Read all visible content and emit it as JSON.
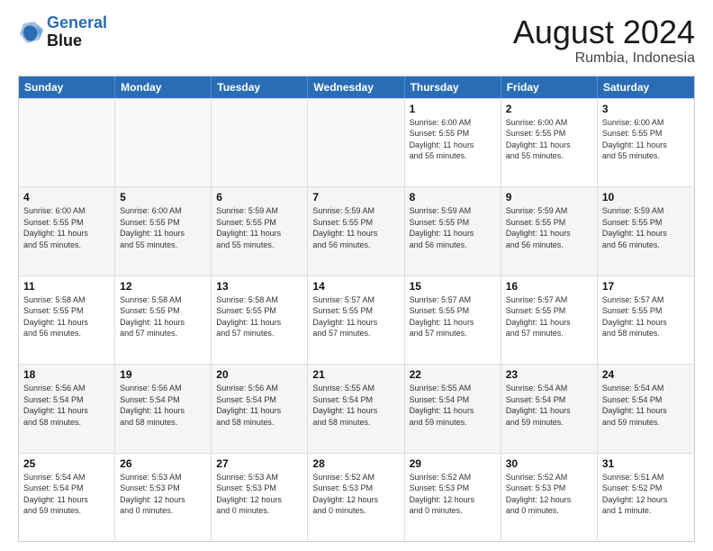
{
  "header": {
    "logo_line1": "General",
    "logo_line2": "Blue",
    "month": "August 2024",
    "location": "Rumbia, Indonesia"
  },
  "weekdays": [
    "Sunday",
    "Monday",
    "Tuesday",
    "Wednesday",
    "Thursday",
    "Friday",
    "Saturday"
  ],
  "rows": [
    [
      {
        "day": "",
        "info": ""
      },
      {
        "day": "",
        "info": ""
      },
      {
        "day": "",
        "info": ""
      },
      {
        "day": "",
        "info": ""
      },
      {
        "day": "1",
        "info": "Sunrise: 6:00 AM\nSunset: 5:55 PM\nDaylight: 11 hours\nand 55 minutes."
      },
      {
        "day": "2",
        "info": "Sunrise: 6:00 AM\nSunset: 5:55 PM\nDaylight: 11 hours\nand 55 minutes."
      },
      {
        "day": "3",
        "info": "Sunrise: 6:00 AM\nSunset: 5:55 PM\nDaylight: 11 hours\nand 55 minutes."
      }
    ],
    [
      {
        "day": "4",
        "info": "Sunrise: 6:00 AM\nSunset: 5:55 PM\nDaylight: 11 hours\nand 55 minutes."
      },
      {
        "day": "5",
        "info": "Sunrise: 6:00 AM\nSunset: 5:55 PM\nDaylight: 11 hours\nand 55 minutes."
      },
      {
        "day": "6",
        "info": "Sunrise: 5:59 AM\nSunset: 5:55 PM\nDaylight: 11 hours\nand 55 minutes."
      },
      {
        "day": "7",
        "info": "Sunrise: 5:59 AM\nSunset: 5:55 PM\nDaylight: 11 hours\nand 56 minutes."
      },
      {
        "day": "8",
        "info": "Sunrise: 5:59 AM\nSunset: 5:55 PM\nDaylight: 11 hours\nand 56 minutes."
      },
      {
        "day": "9",
        "info": "Sunrise: 5:59 AM\nSunset: 5:55 PM\nDaylight: 11 hours\nand 56 minutes."
      },
      {
        "day": "10",
        "info": "Sunrise: 5:59 AM\nSunset: 5:55 PM\nDaylight: 11 hours\nand 56 minutes."
      }
    ],
    [
      {
        "day": "11",
        "info": "Sunrise: 5:58 AM\nSunset: 5:55 PM\nDaylight: 11 hours\nand 56 minutes."
      },
      {
        "day": "12",
        "info": "Sunrise: 5:58 AM\nSunset: 5:55 PM\nDaylight: 11 hours\nand 57 minutes."
      },
      {
        "day": "13",
        "info": "Sunrise: 5:58 AM\nSunset: 5:55 PM\nDaylight: 11 hours\nand 57 minutes."
      },
      {
        "day": "14",
        "info": "Sunrise: 5:57 AM\nSunset: 5:55 PM\nDaylight: 11 hours\nand 57 minutes."
      },
      {
        "day": "15",
        "info": "Sunrise: 5:57 AM\nSunset: 5:55 PM\nDaylight: 11 hours\nand 57 minutes."
      },
      {
        "day": "16",
        "info": "Sunrise: 5:57 AM\nSunset: 5:55 PM\nDaylight: 11 hours\nand 57 minutes."
      },
      {
        "day": "17",
        "info": "Sunrise: 5:57 AM\nSunset: 5:55 PM\nDaylight: 11 hours\nand 58 minutes."
      }
    ],
    [
      {
        "day": "18",
        "info": "Sunrise: 5:56 AM\nSunset: 5:54 PM\nDaylight: 11 hours\nand 58 minutes."
      },
      {
        "day": "19",
        "info": "Sunrise: 5:56 AM\nSunset: 5:54 PM\nDaylight: 11 hours\nand 58 minutes."
      },
      {
        "day": "20",
        "info": "Sunrise: 5:56 AM\nSunset: 5:54 PM\nDaylight: 11 hours\nand 58 minutes."
      },
      {
        "day": "21",
        "info": "Sunrise: 5:55 AM\nSunset: 5:54 PM\nDaylight: 11 hours\nand 58 minutes."
      },
      {
        "day": "22",
        "info": "Sunrise: 5:55 AM\nSunset: 5:54 PM\nDaylight: 11 hours\nand 59 minutes."
      },
      {
        "day": "23",
        "info": "Sunrise: 5:54 AM\nSunset: 5:54 PM\nDaylight: 11 hours\nand 59 minutes."
      },
      {
        "day": "24",
        "info": "Sunrise: 5:54 AM\nSunset: 5:54 PM\nDaylight: 11 hours\nand 59 minutes."
      }
    ],
    [
      {
        "day": "25",
        "info": "Sunrise: 5:54 AM\nSunset: 5:54 PM\nDaylight: 11 hours\nand 59 minutes."
      },
      {
        "day": "26",
        "info": "Sunrise: 5:53 AM\nSunset: 5:53 PM\nDaylight: 12 hours\nand 0 minutes."
      },
      {
        "day": "27",
        "info": "Sunrise: 5:53 AM\nSunset: 5:53 PM\nDaylight: 12 hours\nand 0 minutes."
      },
      {
        "day": "28",
        "info": "Sunrise: 5:52 AM\nSunset: 5:53 PM\nDaylight: 12 hours\nand 0 minutes."
      },
      {
        "day": "29",
        "info": "Sunrise: 5:52 AM\nSunset: 5:53 PM\nDaylight: 12 hours\nand 0 minutes."
      },
      {
        "day": "30",
        "info": "Sunrise: 5:52 AM\nSunset: 5:53 PM\nDaylight: 12 hours\nand 0 minutes."
      },
      {
        "day": "31",
        "info": "Sunrise: 5:51 AM\nSunset: 5:52 PM\nDaylight: 12 hours\nand 1 minute."
      }
    ]
  ]
}
